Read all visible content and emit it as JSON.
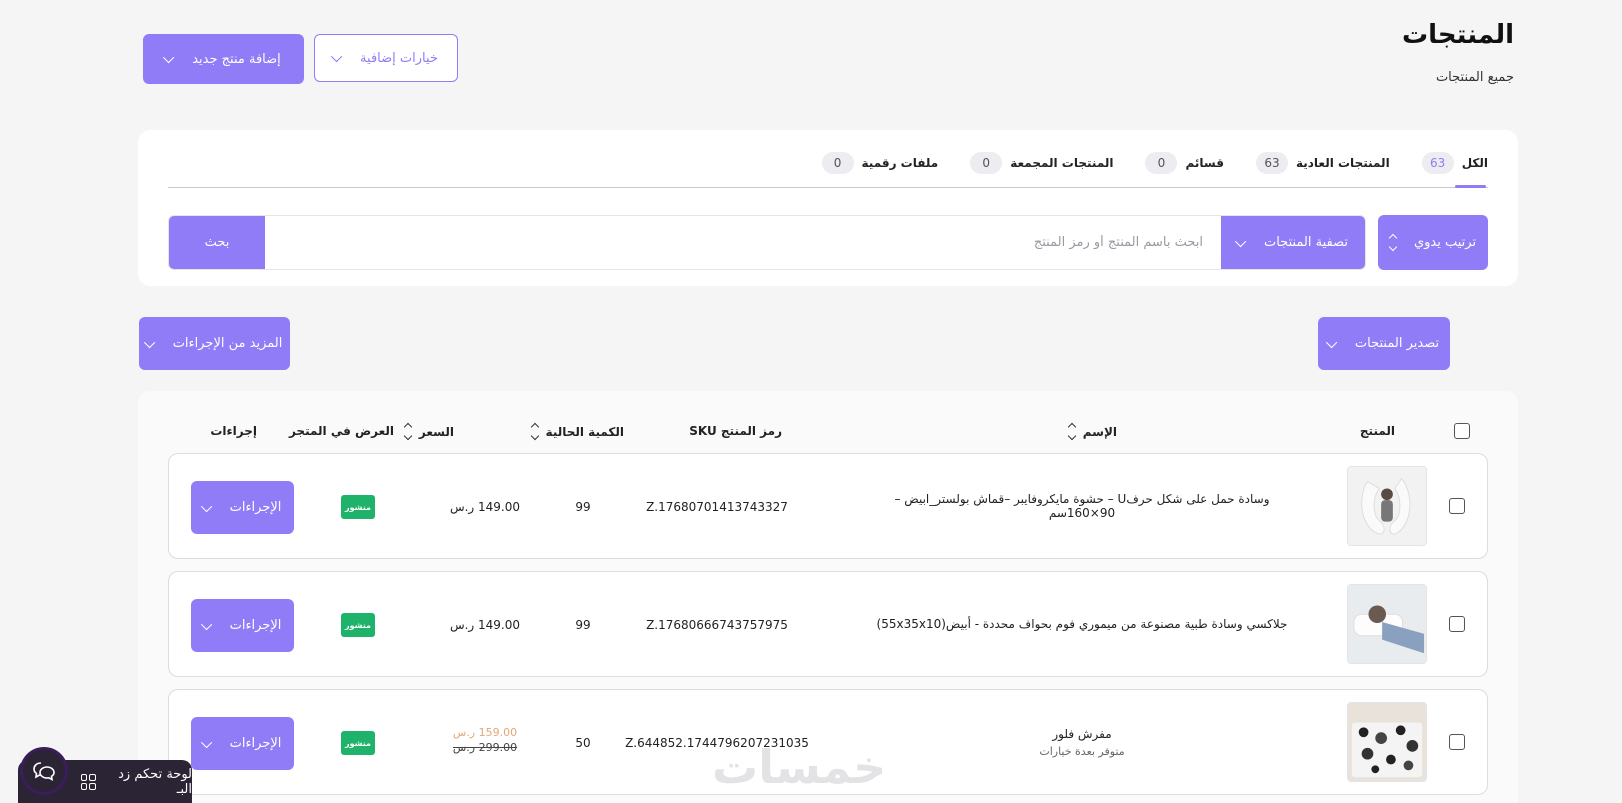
{
  "header": {
    "title": "المنتجات",
    "subtitle": "جميع المنتجات",
    "add_product_label": "إضافة منتج جديد",
    "more_options_label": "خيارات إضافية"
  },
  "tabs": [
    {
      "label": "الكل",
      "count": "63"
    },
    {
      "label": "المنتجات العادية",
      "count": "63"
    },
    {
      "label": "قسائم",
      "count": "0"
    },
    {
      "label": "المنتجات المجمعة",
      "count": "0"
    },
    {
      "label": "ملفات رقمية",
      "count": "0"
    }
  ],
  "filters": {
    "sort_label": "ترتيب يدوي",
    "filter_label": "تصفية المنتجات",
    "search_placeholder": "ابحث باسم المنتج أو رمز المنتج",
    "search_button": "بحث"
  },
  "bulk": {
    "export_label": "تصدير المنتجات",
    "more_actions_label": "المزيد من الإجراءات"
  },
  "table": {
    "headers": {
      "product": "المنتج",
      "name": "الإسم",
      "sku": "رمز المنتج SKU",
      "quantity": "الكمية الحالية",
      "price": "السعر",
      "store_display": "العرض في المتجر",
      "actions": "إجراءات"
    },
    "rows": [
      {
        "name": "وسادة حمل على شكل حرفU – حشوة مايكروفايبر –قماش بولستر_ابيض – 90×160سم",
        "sub": "",
        "sku": "Z.17680701413743327",
        "quantity": "99",
        "price": "149.00 ر.س",
        "sale_price": "",
        "status": "منشور",
        "actions_label": "الإجراءات"
      },
      {
        "name": "جلاكسي وسادة طبية مصنوعة من ميموري فوم بحواف محددة - أبيض(55x35x10)",
        "sub": "",
        "sku": "Z.17680666743757975",
        "quantity": "99",
        "price": "149.00 ر.س",
        "sale_price": "",
        "status": "منشور",
        "actions_label": "الإجراءات"
      },
      {
        "name": "مفرش فلور",
        "sub": "متوفر بعدة خيارات",
        "sku": "Z.644852.1744796207231035",
        "quantity": "50",
        "price": "299.00 ر.س",
        "sale_price": "159.00 ر.س",
        "status": "منشور",
        "actions_label": "الإجراءات"
      }
    ]
  },
  "widgets": {
    "dashboard_label": "لوحة تحكم زد البـ",
    "watermark": "خمسات"
  },
  "colors": {
    "accent": "#8f7cf6",
    "published": "#1fb26a",
    "sale": "#e0a878"
  }
}
